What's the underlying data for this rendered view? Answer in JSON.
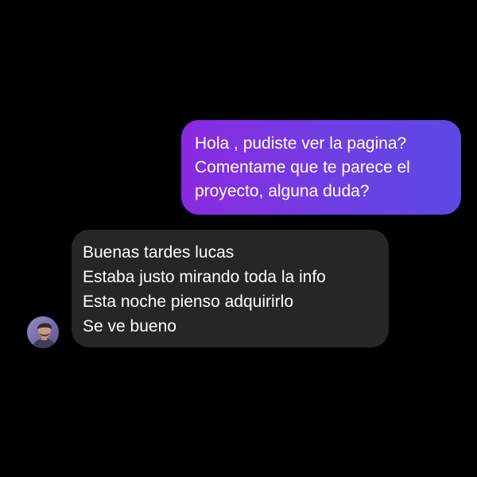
{
  "conversation": {
    "outgoing": {
      "lines": [
        "Hola , pudiste ver la pagina?",
        "Comentame que te parece el",
        "proyecto, alguna duda?"
      ]
    },
    "incoming": {
      "lines": [
        "Buenas tardes lucas",
        "Estaba justo mirando toda la info",
        "Esta noche pienso adquirirlo",
        "Se ve bueno"
      ]
    },
    "avatar_icon": "user-avatar-photo"
  },
  "colors": {
    "background": "#000000",
    "outgoing_bubble_start": "#8a2ae0",
    "outgoing_bubble_end": "#5b4ae4",
    "incoming_bubble": "#262626",
    "text": "#ffffff"
  }
}
